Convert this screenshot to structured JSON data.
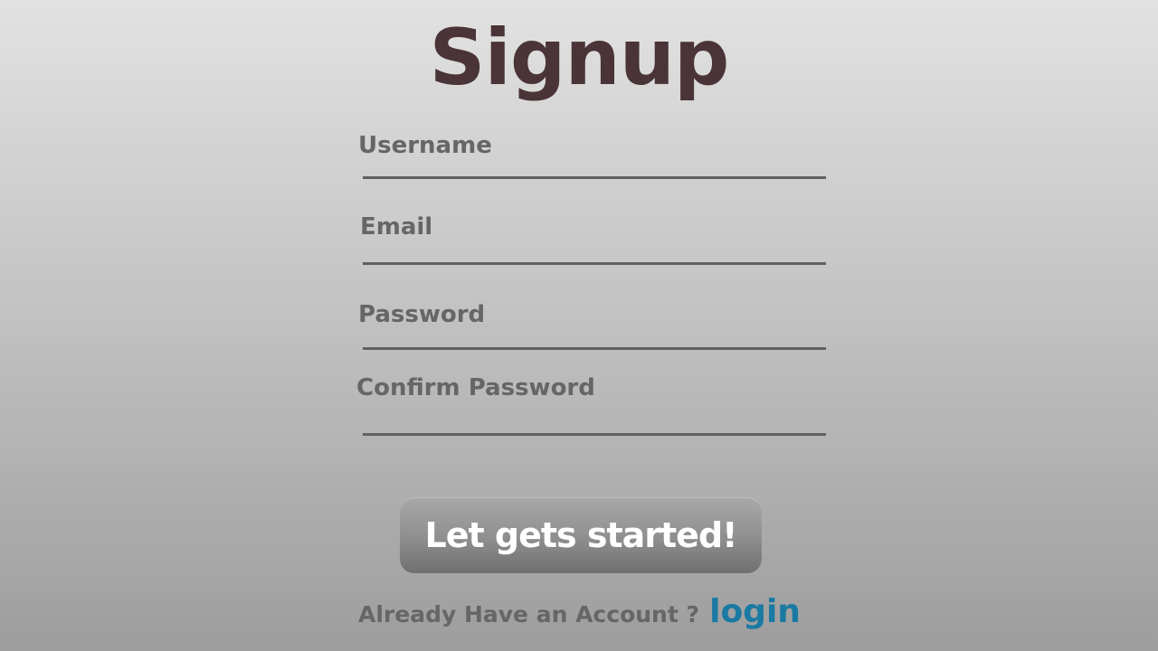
{
  "page": {
    "title": "Signup"
  },
  "form": {
    "username": {
      "label": "Username",
      "value": ""
    },
    "email": {
      "label": "Email",
      "value": ""
    },
    "password": {
      "label": "Password",
      "value": ""
    },
    "confirm_password": {
      "label": "Confirm Password",
      "value": ""
    }
  },
  "submit_button": {
    "label": "Let gets started!"
  },
  "footer": {
    "text": "Already Have an Account ?",
    "link_label": "login"
  },
  "colors": {
    "title": "#4a3438",
    "label": "#666666",
    "link": "#1a7aa3",
    "button_text": "#ffffff"
  }
}
